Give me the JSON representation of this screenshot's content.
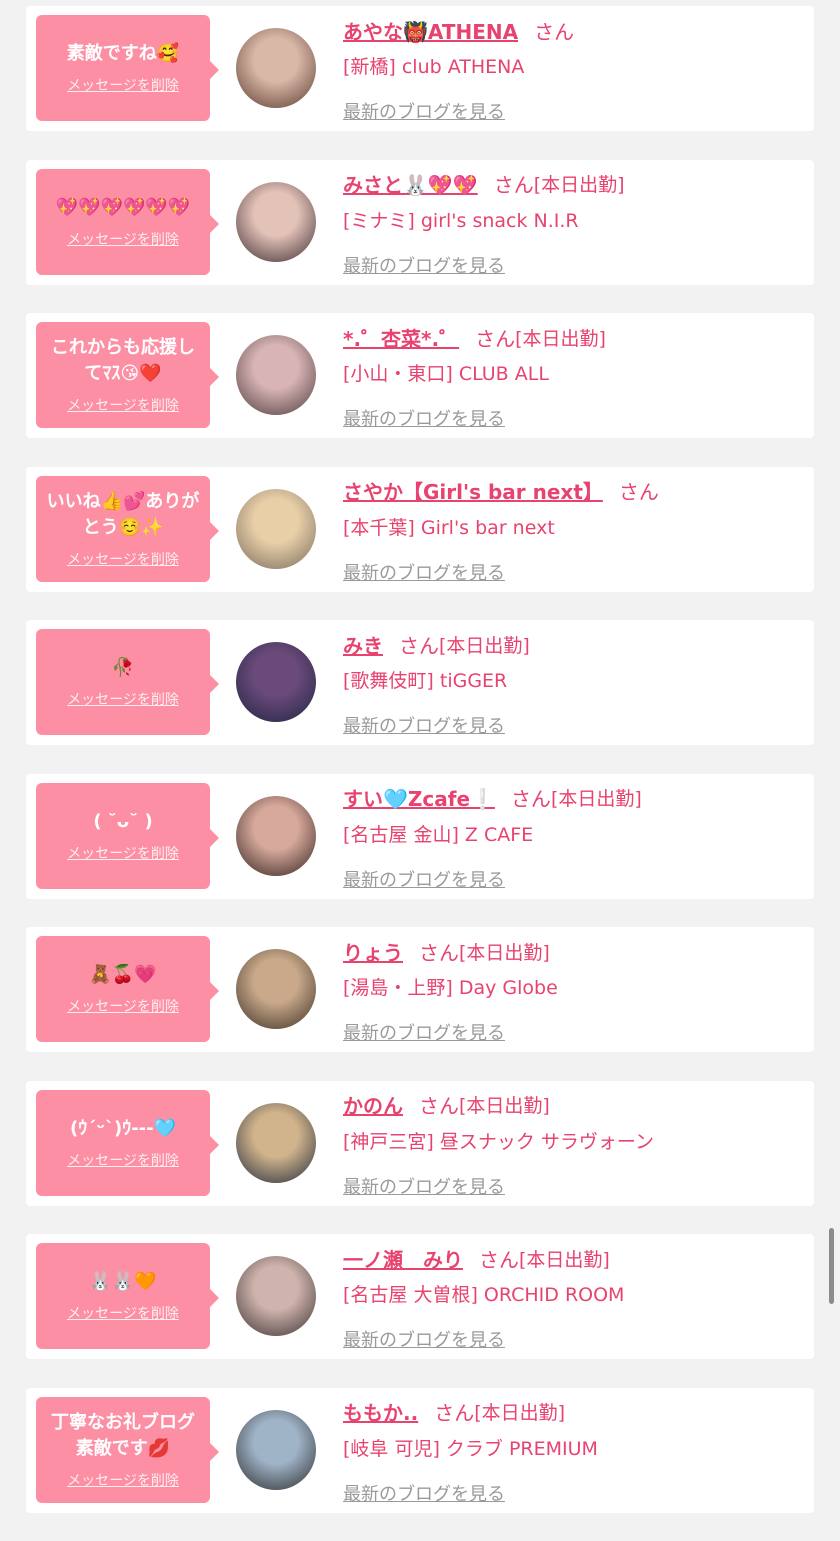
{
  "labels": {
    "delete_message": "メッセージを削除",
    "san": "さん",
    "latest_blog": "最新のブログを見る"
  },
  "items": [
    {
      "message": "素敵ですね🥰",
      "name": "あやな👹ATHENA",
      "duty": "",
      "shop": "[新橋] club ATHENA",
      "avatar_colors": [
        "#d9b8a8",
        "#5a3a2c"
      ]
    },
    {
      "message": "💖💖💖💖💖💖",
      "name": "みさと🐰💖💖",
      "duty": "[本日出勤]",
      "shop": "[ミナミ] girl's snack N.I.R",
      "avatar_colors": [
        "#e3c2b8",
        "#3b2b2f"
      ]
    },
    {
      "message": "これからも応援してﾏｽ😘❤️",
      "name": "*.゜杏菜*.゜",
      "duty": "[本日出勤]",
      "shop": "[小山・東口] CLUB ALL",
      "avatar_colors": [
        "#d8b4b6",
        "#4d3b3a"
      ]
    },
    {
      "message": "いいね👍💕ありがとう☺️✨",
      "name": "さやか【Girl's bar next】",
      "duty": "",
      "shop": "[本千葉] Girl's bar next",
      "avatar_colors": [
        "#e8cfa8",
        "#7a6a5c"
      ]
    },
    {
      "message": "🥀",
      "name": "みき",
      "duty": "[本日出勤]",
      "shop": "[歌舞伎町] tiGGER",
      "avatar_colors": [
        "#6a4a7a",
        "#1f2440"
      ]
    },
    {
      "message": "( ˘ᴗ˘ )",
      "name": "すい🩵Zcafe❕",
      "duty": "[本日出勤]",
      "shop": "[名古屋 金山] Z CAFE",
      "avatar_colors": [
        "#d7a89c",
        "#2f211c"
      ]
    },
    {
      "message": "🧸🍒💗",
      "name": "りょう",
      "duty": "[本日出勤]",
      "shop": "[湯島・上野] Day Globe",
      "avatar_colors": [
        "#c9a98a",
        "#3a2e24"
      ]
    },
    {
      "message": "(ｳ´ᵕ`)ｳ---🩵",
      "name": "かのん",
      "duty": "[本日出勤]",
      "shop": "[神戸三宮] 昼スナック サラヴォーン",
      "avatar_colors": [
        "#d2b48c",
        "#1f2a3a"
      ]
    },
    {
      "message": "🐰🐰🧡",
      "name": "一ノ瀬　みり",
      "duty": "[本日出勤]",
      "shop": "[名古屋 大曽根] ORCHID ROOM",
      "avatar_colors": [
        "#cfb3ad",
        "#3a3030"
      ]
    },
    {
      "message": "丁寧なお礼ブログ素敵です💋",
      "name": "ももか..",
      "duty": "[本日出勤]",
      "shop": "[岐阜 可児] クラブ PREMIUM",
      "avatar_colors": [
        "#a0b4c8",
        "#2a2a2a"
      ]
    }
  ]
}
